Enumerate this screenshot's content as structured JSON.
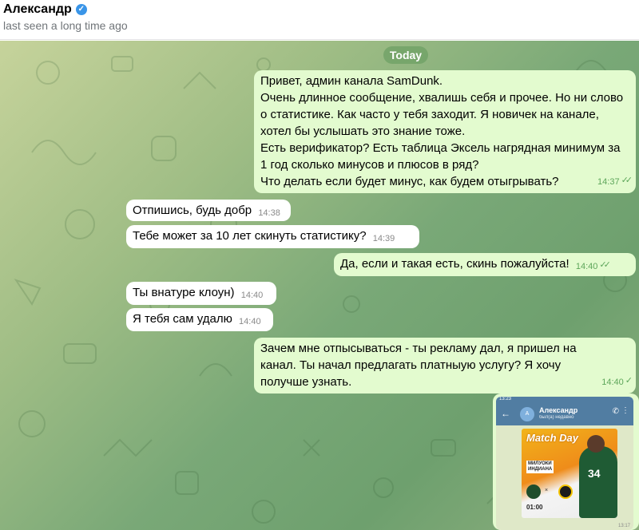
{
  "header": {
    "name": "Александр",
    "status": "last seen a long time ago"
  },
  "chat": {
    "date": "Today",
    "messages": [
      {
        "text": "Привет, админ канала SamDunk.\nОчень длинное сообщение, хвалишь себя и прочее. Но ни слово о статистике. Как часто у тебя заходит. Я новичек на канале, хотел бы услышать это знание тоже.\nЕсть верификатор? Есть таблица Эксель нагрядная минимум за 1 год сколько минусов и плюсов в ряд?\nЧто делать если будет минус, как будем отыгрывать?",
        "time": "14:37"
      },
      {
        "text": "Отпишись, будь добр",
        "time": "14:38"
      },
      {
        "text": "Тебе может за 10 лет скинуть статистику?",
        "time": "14:39"
      },
      {
        "text": "Да, если и такая есть, скинь пожалуйста!",
        "time": "14:40"
      },
      {
        "text": "Ты внатуре клоун)",
        "time": "14:40"
      },
      {
        "text": "Я тебя сам удалю",
        "time": "14:40"
      },
      {
        "text": "Зачем мне отпысываться - ты рекламу дал, я пришел на канал. Ты начал предлагать платныую услугу? Я хочу получше узнать.",
        "time": "14:40"
      }
    ],
    "screenshot": {
      "status_time": "13:23",
      "name": "Александр",
      "sub": "был(а) недавно",
      "avatar_letter": "А",
      "poster_title": "Match Day",
      "poster_teams": "МИЛУОКИ\nИНДИАНА",
      "poster_number": "34",
      "poster_time": "01:00",
      "meta": "13:17"
    }
  }
}
